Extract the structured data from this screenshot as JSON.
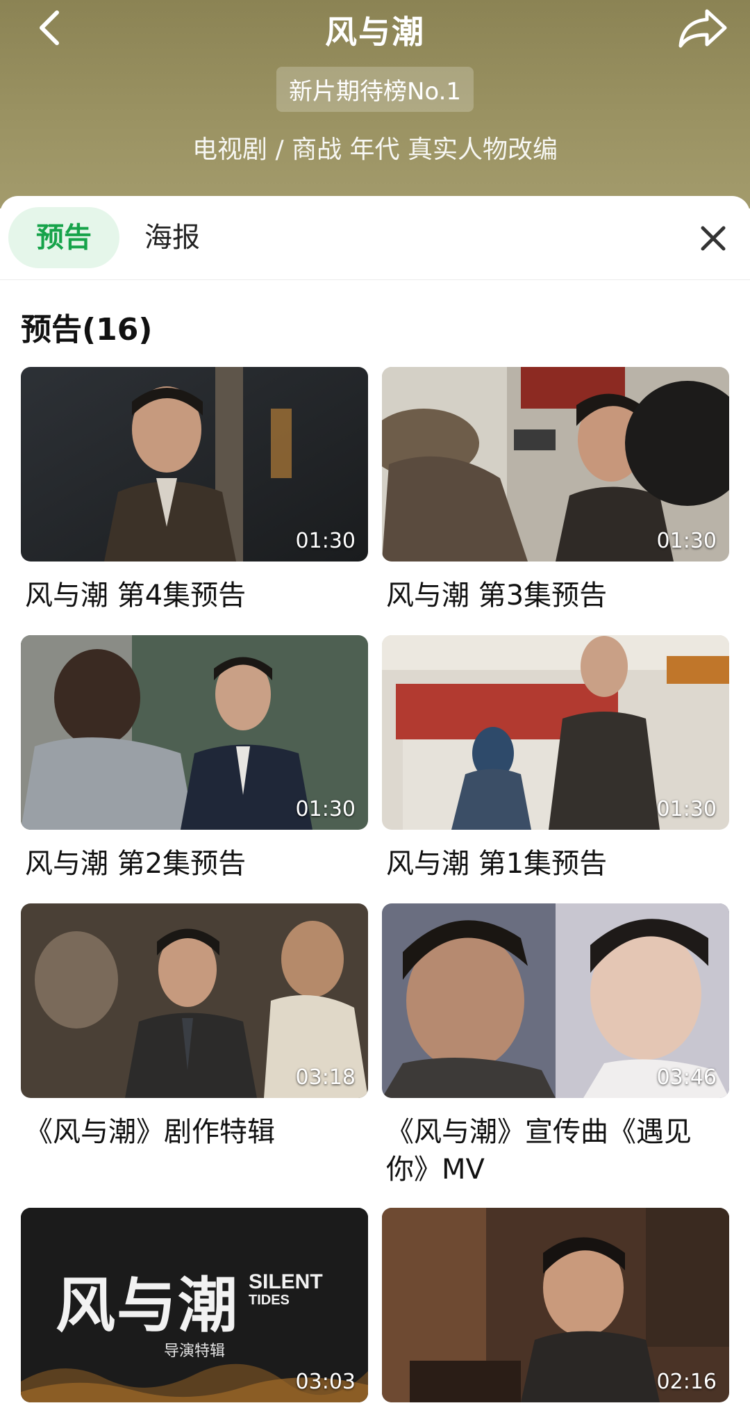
{
  "header": {
    "title": "风与潮",
    "rank_badge": "新片期待榜No.1",
    "genre": "电视剧 / 商战 年代 真实人物改编",
    "back_icon": "chevron-left-icon",
    "share_icon": "share-icon"
  },
  "tabs": [
    {
      "label": "预告",
      "active": true
    },
    {
      "label": "海报",
      "active": false
    }
  ],
  "close_icon": "close-icon",
  "section": {
    "title": "预告(16)"
  },
  "videos": [
    {
      "title": "风与潮 第4集预告",
      "duration": "01:30"
    },
    {
      "title": "风与潮 第3集预告",
      "duration": "01:30"
    },
    {
      "title": "风与潮 第2集预告",
      "duration": "01:30"
    },
    {
      "title": "风与潮 第1集预告",
      "duration": "01:30"
    },
    {
      "title": "《风与潮》剧作特辑",
      "duration": "03:18"
    },
    {
      "title": "《风与潮》宣传曲《遇见你》MV",
      "duration": "03:46"
    },
    {
      "title": "",
      "duration": "03:03",
      "thumb_text": {
        "cn": "风与潮",
        "en_line1": "SILENT",
        "en_line2": "TIDES",
        "sub": "导演特辑"
      }
    },
    {
      "title": "",
      "duration": "02:16"
    }
  ],
  "colors": {
    "accent": "#16a34a",
    "tab_active_bg": "#e5f6ea",
    "header_bg": "#958d5d"
  }
}
